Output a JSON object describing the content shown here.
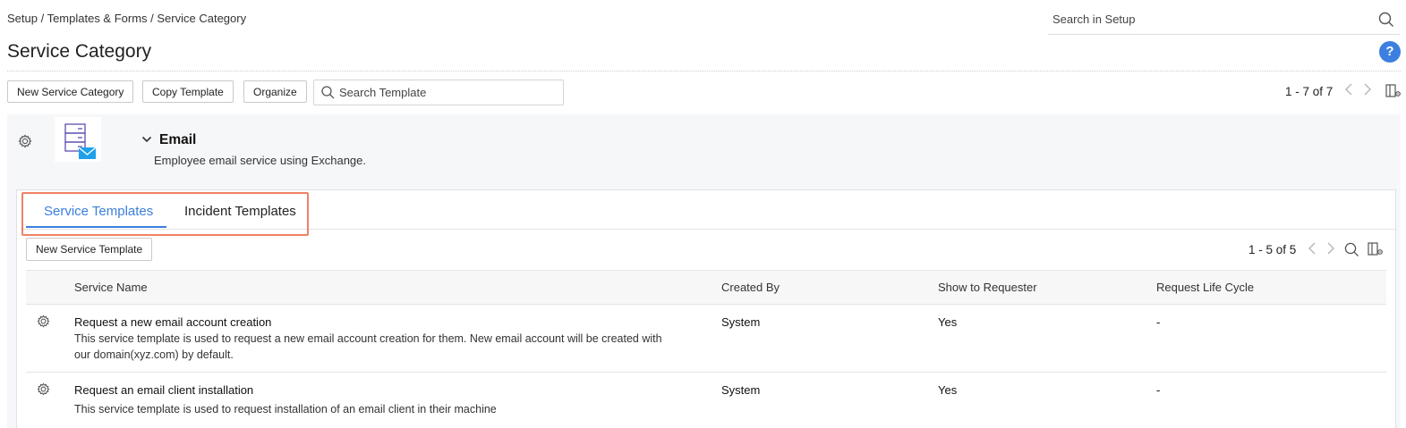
{
  "breadcrumb": "Setup / Templates & Forms / Service Category",
  "setup_search": {
    "placeholder": "Search in Setup"
  },
  "page": {
    "title": "Service Category",
    "help_label": "?"
  },
  "toolbar": {
    "new_category_label": "New Service Category",
    "copy_template_label": "Copy Template",
    "organize_label": "Organize",
    "search_placeholder": "Search Template",
    "pagination": "1 - 7 of 7"
  },
  "category": {
    "name": "Email",
    "description": "Employee email service using Exchange."
  },
  "tabs": [
    {
      "label": "Service Templates",
      "active": true
    },
    {
      "label": "Incident Templates",
      "active": false
    }
  ],
  "templates": {
    "new_button_label": "New Service Template",
    "pagination": "1 - 5 of 5",
    "columns": [
      "Service Name",
      "Created By",
      "Show to Requester",
      "Request Life Cycle"
    ],
    "rows": [
      {
        "name": "Request a new email account creation",
        "description_line1": "This service template is used to request a new email account creation for them. New email account will be created with",
        "description_line2": "our domain(xyz.com) by default.",
        "created_by": "System",
        "show_to_requester": "Yes",
        "life_cycle": "-"
      },
      {
        "name": "Request an email client installation",
        "description_line1": "This service template is used to request installation of an email client in their machine",
        "description_line2": "",
        "created_by": "System",
        "show_to_requester": "Yes",
        "life_cycle": "-"
      }
    ]
  },
  "colors": {
    "accent": "#3b7fdc",
    "highlight_border": "#ef8266",
    "help_badge": "#3d7fe0"
  },
  "icons": [
    "search-icon",
    "help-icon",
    "chevron-left-icon",
    "chevron-right-icon",
    "column-settings-icon",
    "gear-icon",
    "server-mail-icon",
    "chevron-down-icon"
  ]
}
